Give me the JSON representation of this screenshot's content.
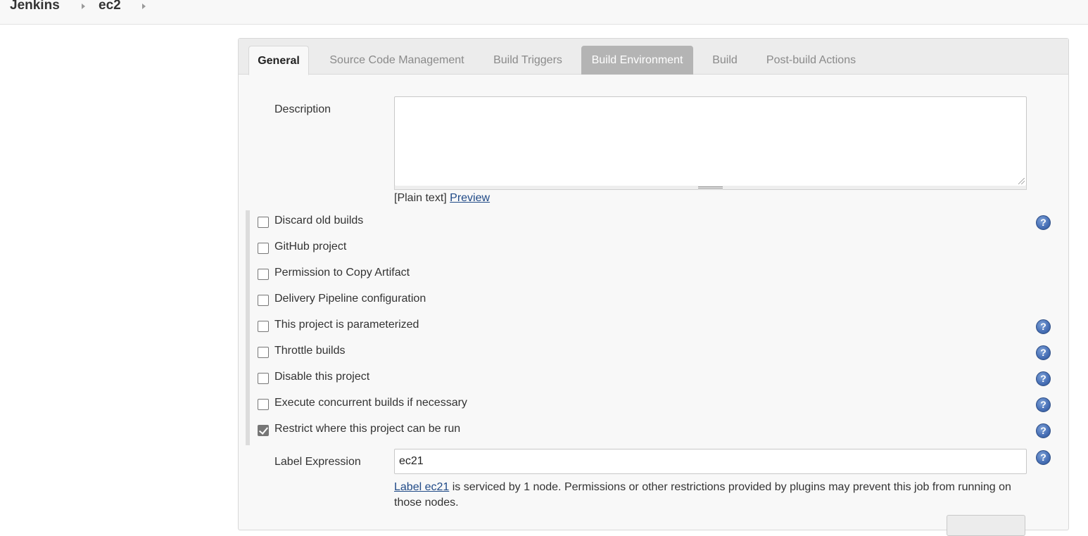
{
  "breadcrumb": {
    "items": [
      "Jenkins",
      "ec2"
    ]
  },
  "tabs": [
    {
      "label": "General",
      "state": "active"
    },
    {
      "label": "Source Code Management",
      "state": "normal"
    },
    {
      "label": "Build Triggers",
      "state": "normal"
    },
    {
      "label": "Build Environment",
      "state": "hover"
    },
    {
      "label": "Build",
      "state": "normal"
    },
    {
      "label": "Post-build Actions",
      "state": "normal"
    }
  ],
  "description": {
    "label": "Description",
    "value": "",
    "format_prefix": "[Plain text]",
    "preview_link": "Preview"
  },
  "options": [
    {
      "label": "Discard old builds",
      "checked": false,
      "help": true
    },
    {
      "label": "GitHub project",
      "checked": false,
      "help": false
    },
    {
      "label": "Permission to Copy Artifact",
      "checked": false,
      "help": false
    },
    {
      "label": "Delivery Pipeline configuration",
      "checked": false,
      "help": false
    },
    {
      "label": "This project is parameterized",
      "checked": false,
      "help": true
    },
    {
      "label": "Throttle builds",
      "checked": false,
      "help": true
    },
    {
      "label": "Disable this project",
      "checked": false,
      "help": true
    },
    {
      "label": "Execute concurrent builds if necessary",
      "checked": false,
      "help": true
    },
    {
      "label": "Restrict where this project can be run",
      "checked": true,
      "help": true
    }
  ],
  "label_expression": {
    "label": "Label Expression",
    "value": "ec21",
    "info_link": "Label ec21",
    "info_text": " is serviced by 1 node. Permissions or other restrictions provided by plugins may prevent this job from running on those nodes."
  },
  "help_glyph": "?",
  "colors": {
    "accent_link": "#204a87",
    "help_icon": "#4a72b8",
    "tab_hover_bg": "#b4b4b4"
  }
}
